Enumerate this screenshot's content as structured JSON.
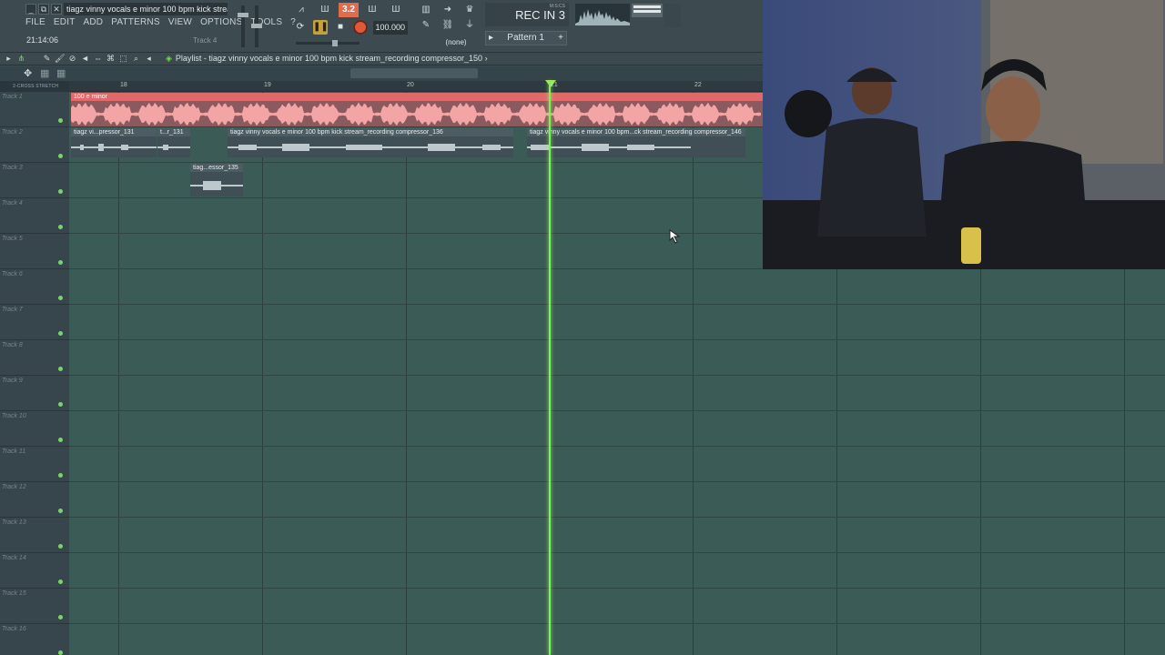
{
  "window": {
    "title": "tiagz vinny vocals e minor 100 bpm kick stream",
    "min_btn": "_",
    "max_btn": "⧉",
    "close_btn": "✕"
  },
  "menu": [
    "FILE",
    "EDIT",
    "ADD",
    "PATTERNS",
    "VIEW",
    "OPTIONS",
    "TOOLS",
    "?"
  ],
  "status": {
    "time": "21:14:06",
    "hint": "Track 4"
  },
  "toolbar": {
    "bpm_indicator": "3.2",
    "tempo": "100.000",
    "recin_small": "M:S:CS",
    "recin": "REC IN 3",
    "channel_none": "(none)",
    "pattern": "Pattern 1",
    "pattern_add": "+",
    "pattern_prev": "▸"
  },
  "playlist": {
    "title": "Playlist - tiagz vinny vocals e minor 100 bpm kick stream_recording compressor_150",
    "arrow": "›",
    "left_label": "2-CROSS  STRETCH"
  },
  "ruler": {
    "bars": [
      "18",
      "19",
      "20",
      "21",
      "22"
    ]
  },
  "tracks": [
    {
      "name": "Track 1"
    },
    {
      "name": "Track 2"
    },
    {
      "name": "Track 3"
    },
    {
      "name": "Track 4"
    },
    {
      "name": "Track 5"
    },
    {
      "name": "Track 6"
    },
    {
      "name": "Track 7"
    },
    {
      "name": "Track 8"
    },
    {
      "name": "Track 9"
    },
    {
      "name": "Track 10"
    },
    {
      "name": "Track 11"
    },
    {
      "name": "Track 12"
    },
    {
      "name": "Track 13"
    },
    {
      "name": "Track 14"
    },
    {
      "name": "Track 15"
    },
    {
      "name": "Track 16"
    }
  ],
  "clips": {
    "track1": "100 e minor",
    "track2_a": "tiagz vi...pressor_131",
    "track2_b": "t...r_131",
    "track2_c": "tiagz vinny vocals e minor 100 bpm kick stream_recording compressor_136",
    "track2_d": "tiagz vinny vocals e minor 100 bpm...ck stream_recording compressor_146",
    "track3": "tiag...essor_135"
  },
  "colors": {
    "accent_green": "#7cf25a",
    "clip_red": "#e06a6a",
    "grid_bg": "#3b5b57"
  }
}
